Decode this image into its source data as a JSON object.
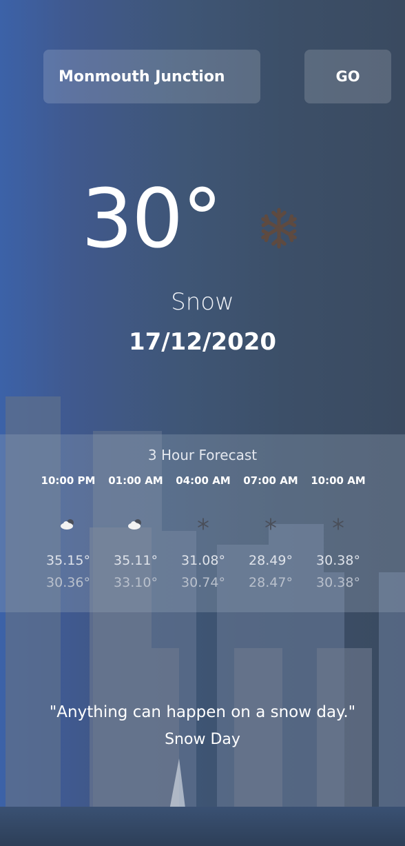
{
  "search": {
    "city_value": "Monmouth Junction",
    "go_label": "GO"
  },
  "current": {
    "temperature": "30°",
    "condition": "Snow",
    "date": "17/12/2020",
    "icon": "snowflake-icon"
  },
  "forecast": {
    "title": "3 Hour Forecast",
    "items": [
      {
        "time": "10:00 PM",
        "icon": "cloud-icon",
        "high": "35.15°",
        "low": "30.36°"
      },
      {
        "time": "01:00 AM",
        "icon": "cloud-icon",
        "high": "35.11°",
        "low": "33.10°"
      },
      {
        "time": "04:00 AM",
        "icon": "snowflake-icon",
        "high": "31.08°",
        "low": "30.74°"
      },
      {
        "time": "07:00 AM",
        "icon": "snowflake-icon",
        "high": "28.49°",
        "low": "28.47°"
      },
      {
        "time": "10:00 AM",
        "icon": "snowflake-icon",
        "high": "30.38°",
        "low": "30.38°"
      }
    ]
  },
  "quote": {
    "text": "\"Anything can happen on a snow day.\"",
    "author": "Snow Day"
  },
  "colors": {
    "icon_brown": "#5e4a40",
    "forecast_panel": "#96a5b9"
  }
}
